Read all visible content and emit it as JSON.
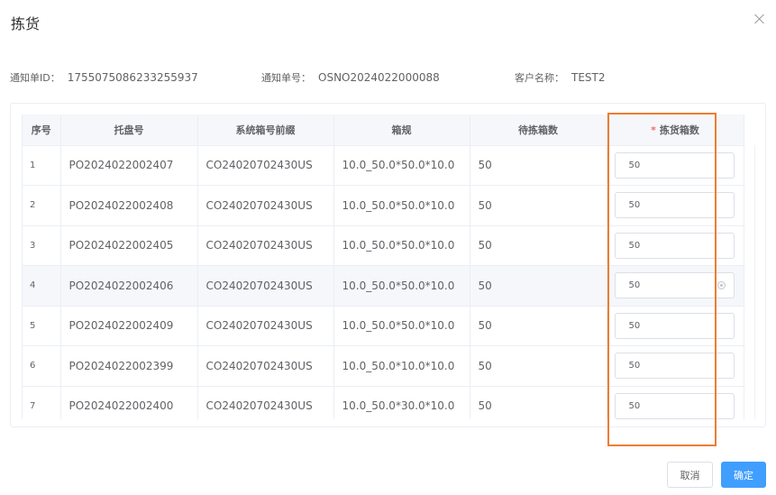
{
  "dialog": {
    "title": "拣货"
  },
  "info": {
    "notice_id_label": "通知单ID：",
    "notice_id_value": "1755075086233255937",
    "notice_no_label": "通知单号：",
    "notice_no_value": "OSNO2024022000088",
    "customer_label": "客户名称：",
    "customer_value": "TEST2"
  },
  "table": {
    "headers": {
      "index": "序号",
      "pallet": "托盘号",
      "box_prefix": "系统箱号前缀",
      "spec": "箱规",
      "pending": "待拣箱数",
      "picked_required": "*",
      "picked": "拣货箱数"
    },
    "rows": [
      {
        "index": "1",
        "pallet": "PO2024022002407",
        "box_prefix": "CO24020702430US",
        "spec": "10.0_50.0*50.0*10.0",
        "pending": "50",
        "picked": "50"
      },
      {
        "index": "2",
        "pallet": "PO2024022002408",
        "box_prefix": "CO24020702430US",
        "spec": "10.0_50.0*50.0*10.0",
        "pending": "50",
        "picked": "50"
      },
      {
        "index": "3",
        "pallet": "PO2024022002405",
        "box_prefix": "CO24020702430US",
        "spec": "10.0_50.0*50.0*10.0",
        "pending": "50",
        "picked": "50"
      },
      {
        "index": "4",
        "pallet": "PO2024022002406",
        "box_prefix": "CO24020702430US",
        "spec": "10.0_50.0*50.0*10.0",
        "pending": "50",
        "picked": "50"
      },
      {
        "index": "5",
        "pallet": "PO2024022002409",
        "box_prefix": "CO24020702430US",
        "spec": "10.0_50.0*50.0*10.0",
        "pending": "50",
        "picked": "50"
      },
      {
        "index": "6",
        "pallet": "PO2024022002399",
        "box_prefix": "CO24020702430US",
        "spec": "10.0_50.0*10.0*10.0",
        "pending": "50",
        "picked": "50"
      },
      {
        "index": "7",
        "pallet": "PO2024022002400",
        "box_prefix": "CO24020702430US",
        "spec": "10.0_50.0*30.0*10.0",
        "pending": "50",
        "picked": "50"
      }
    ]
  },
  "footer": {
    "cancel_label": "取消",
    "ok_label": "确定"
  },
  "colors": {
    "primary": "#409eff",
    "highlight": "#ee7c33",
    "required": "#f56c6c"
  }
}
